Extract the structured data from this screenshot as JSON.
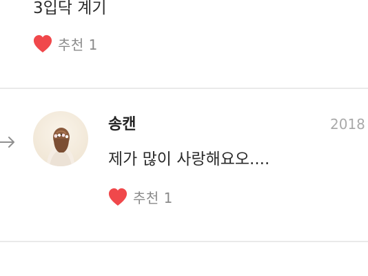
{
  "previous_comment": {
    "text_fragment": "3입닥 계기",
    "like_label": "추천 1"
  },
  "comment": {
    "author": "송캔",
    "date": "2018",
    "text": "제가 많이 사랑해요오....",
    "like_label": "추천 1"
  },
  "colors": {
    "heart": "#f0484b",
    "divider": "#e9e9e9",
    "muted_text": "#8a8a8a",
    "date_text": "#a9a9a9"
  },
  "icons": {
    "like": "heart-icon",
    "reply": "reply-arrow-icon"
  }
}
